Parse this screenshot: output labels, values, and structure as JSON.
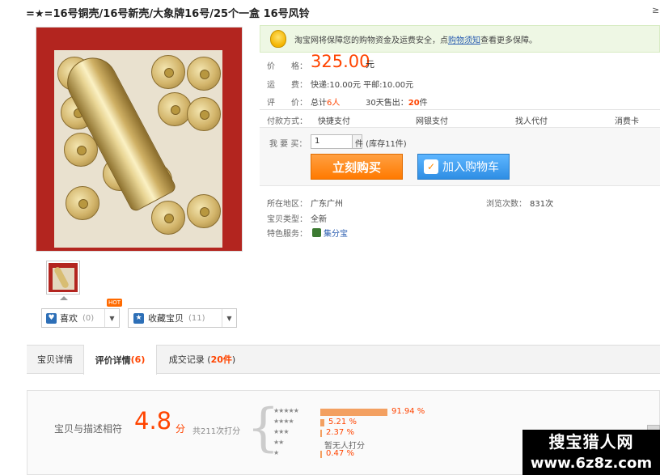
{
  "title": "=★=16号铜壳/16号新壳/大象牌16号/25个一盒 16号风铃",
  "corner_glyph": "≥",
  "photo": {
    "alt": "brass shotgun shell casings in red box"
  },
  "actions": {
    "like": {
      "label": "喜欢",
      "count": "(0)",
      "badge": "HOT"
    },
    "favorite": {
      "label": "收藏宝贝",
      "count": "(11)"
    }
  },
  "guarantee": {
    "text_before": "淘宝网将保障您的购物资金及运费安全，点",
    "link": "购物须知",
    "text_after": "查看更多保障。"
  },
  "price": {
    "label": "价　　格：",
    "value": "325.00",
    "unit": "元"
  },
  "shipping": {
    "label": "运　　费：",
    "text": "快递:10.00元 平邮:10.00元"
  },
  "review": {
    "label": "评　　价：",
    "total_prefix": "总计",
    "total_count": "6人",
    "sold_prefix": "30天售出：",
    "sold_count": "20",
    "sold_unit": "件"
  },
  "payment": {
    "label": "付款方式：",
    "methods": [
      "快捷支付",
      "网银支付",
      "找人代付",
      "消费卡"
    ]
  },
  "buy": {
    "qty_label": "我 要 买：",
    "qty_value": "1",
    "stock_text": "件 (库存11件)",
    "buy_now": "立刻购买",
    "add_cart": "加入购物车",
    "cart_icon_glyph": "✓"
  },
  "meta": {
    "location_label": "所在地区：",
    "location": "广东广州",
    "views_label": "浏览次数：",
    "views": "831次",
    "condition_label": "宝贝类型：",
    "condition": "全新",
    "service_label": "特色服务：",
    "service": "集分宝"
  },
  "tabs": [
    {
      "label": "宝贝详情",
      "num": "",
      "active": false
    },
    {
      "label": "评价详情",
      "num": "(6)",
      "active": true
    },
    {
      "label": "成交记录 (",
      "num": "20件",
      "suffix": ")",
      "active": false
    }
  ],
  "rating": {
    "label": "宝贝与描述相符",
    "score": "4.8",
    "unit": "分",
    "total": "共211次打分",
    "breakdown": [
      {
        "stars": "★★★★★",
        "percent_text": "91.94 %",
        "percent": 91.94
      },
      {
        "stars": "★★★★",
        "percent_text": "5.21 %",
        "percent": 5.21
      },
      {
        "stars": "★★★",
        "percent_text": "2.37 %",
        "percent": 2.37
      },
      {
        "stars": "★★",
        "percent_text": "暂无人打分",
        "percent": 0
      },
      {
        "stars": "★",
        "percent_text": "0.47 %",
        "percent": 0.47
      }
    ]
  },
  "watermark": {
    "line1": "搜宝猎人网",
    "line2": "www.6z8z.com"
  },
  "colors": {
    "accent": "#ff4400",
    "buy_button": "#ff8800",
    "cart_button": "#3a9be8",
    "guarantee_bg": "#eef7e4"
  }
}
